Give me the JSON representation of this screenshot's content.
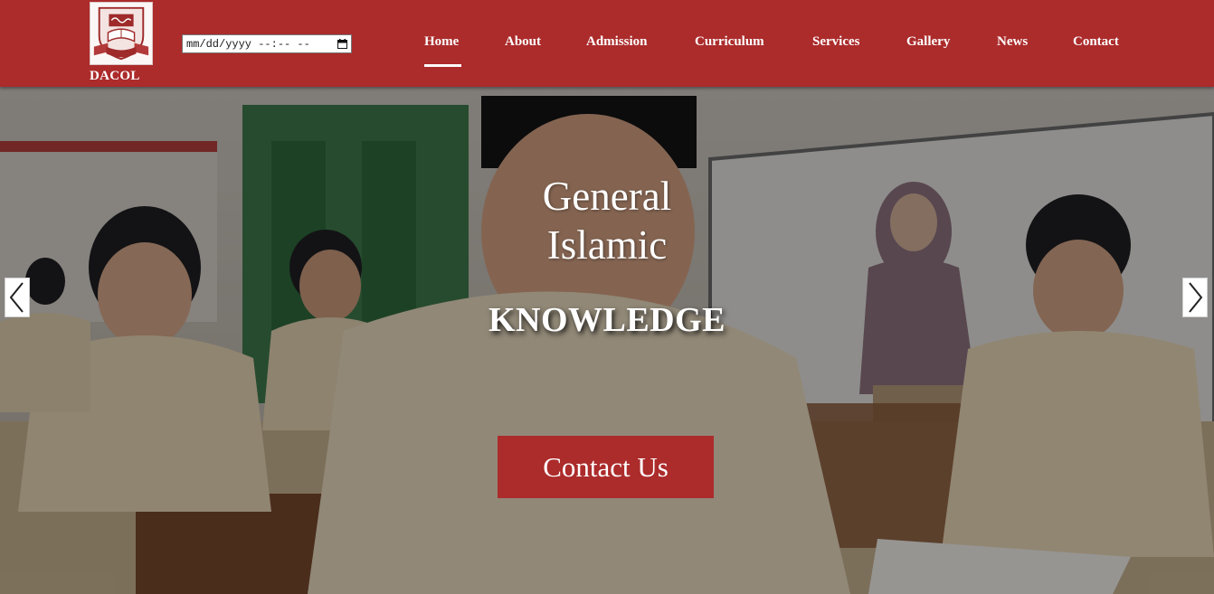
{
  "brand": {
    "name": "DACOL"
  },
  "datetime_input": {
    "value": "mm/dd/yyyy --:-- --"
  },
  "nav": {
    "items": [
      {
        "label": "Home",
        "active": true
      },
      {
        "label": "About"
      },
      {
        "label": "Admission"
      },
      {
        "label": "Curriculum"
      },
      {
        "label": "Services"
      },
      {
        "label": "Gallery"
      },
      {
        "label": "News"
      },
      {
        "label": "Contact"
      }
    ]
  },
  "hero": {
    "line1": "General",
    "line2": "Islamic",
    "emphasis": "KNOWLEDGE",
    "cta_label": "Contact Us"
  },
  "carousel": {
    "prev_icon": "chevron-left-icon",
    "next_icon": "chevron-right-icon"
  },
  "colors": {
    "header": "#ac2b2b",
    "cta": "#ac2b2b",
    "text": "#ffffff"
  }
}
